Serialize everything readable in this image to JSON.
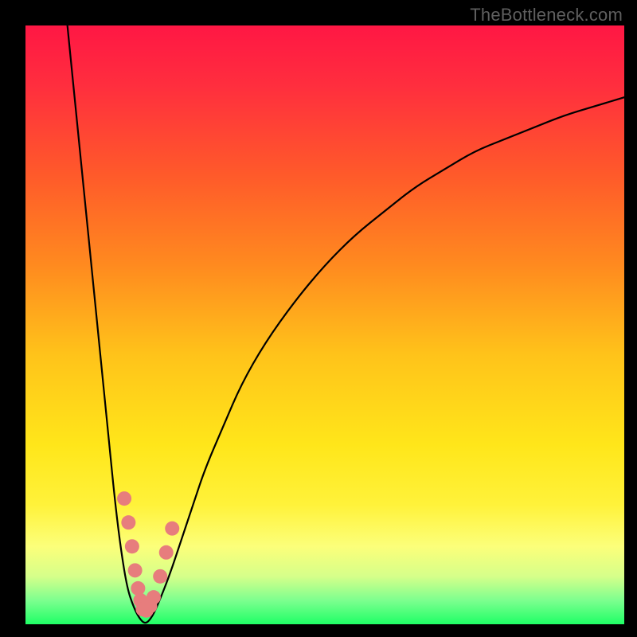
{
  "watermark": "TheBottleneck.com",
  "colors": {
    "marker_fill": "#e77d7d",
    "curve_stroke": "#000000",
    "frame_bg": "#000000",
    "gradient_stops": [
      {
        "offset": 0.0,
        "color": "#ff1744"
      },
      {
        "offset": 0.1,
        "color": "#ff2e3e"
      },
      {
        "offset": 0.25,
        "color": "#ff5a2a"
      },
      {
        "offset": 0.4,
        "color": "#ff8a1f"
      },
      {
        "offset": 0.55,
        "color": "#ffc31a"
      },
      {
        "offset": 0.7,
        "color": "#ffe61a"
      },
      {
        "offset": 0.8,
        "color": "#fff23a"
      },
      {
        "offset": 0.87,
        "color": "#fcff7a"
      },
      {
        "offset": 0.92,
        "color": "#d6ff8a"
      },
      {
        "offset": 0.96,
        "color": "#7dff8f"
      },
      {
        "offset": 1.0,
        "color": "#1fff66"
      }
    ]
  },
  "chart_data": {
    "type": "line",
    "title": "",
    "xlabel": "",
    "ylabel": "",
    "xlim": [
      0,
      100
    ],
    "ylim": [
      0,
      100
    ],
    "grid": false,
    "legend": false,
    "series": [
      {
        "name": "bottleneck-curve",
        "x": [
          7,
          8,
          9,
          10,
          11,
          12,
          13,
          14,
          15,
          16,
          17,
          18,
          19,
          20,
          21,
          22,
          24,
          26,
          28,
          30,
          33,
          36,
          40,
          45,
          50,
          55,
          60,
          65,
          70,
          75,
          80,
          85,
          90,
          95,
          100
        ],
        "y": [
          100,
          90,
          80,
          70,
          60,
          50,
          40,
          30,
          20,
          12,
          6,
          3,
          1,
          0,
          1,
          3,
          8,
          14,
          20,
          26,
          33,
          40,
          47,
          54,
          60,
          65,
          69,
          73,
          76,
          79,
          81,
          83,
          85,
          86.5,
          88
        ]
      }
    ],
    "markers": {
      "name": "bottleneck-markers",
      "points": [
        {
          "x": 16.5,
          "y": 21
        },
        {
          "x": 17.2,
          "y": 17
        },
        {
          "x": 17.8,
          "y": 13
        },
        {
          "x": 18.3,
          "y": 9
        },
        {
          "x": 18.8,
          "y": 6
        },
        {
          "x": 19.2,
          "y": 4
        },
        {
          "x": 19.6,
          "y": 2.5
        },
        {
          "x": 20.2,
          "y": 2.3
        },
        {
          "x": 20.8,
          "y": 3
        },
        {
          "x": 21.4,
          "y": 4.5
        },
        {
          "x": 22.5,
          "y": 8
        },
        {
          "x": 23.5,
          "y": 12
        },
        {
          "x": 24.5,
          "y": 16
        }
      ],
      "radius": 9
    }
  }
}
